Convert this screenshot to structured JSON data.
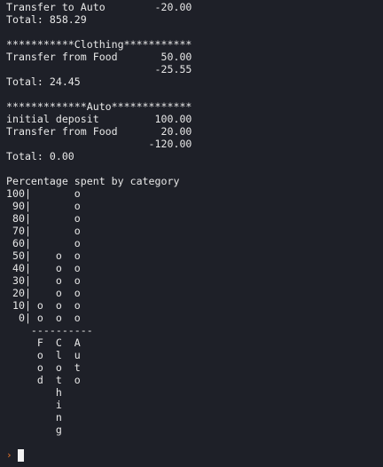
{
  "terminal": {
    "lines": [
      "Transfer to Auto        -20.00",
      "Total: 858.29",
      "",
      "***********Clothing***********",
      "Transfer from Food       50.00",
      "                        -25.55",
      "Total: 24.45",
      "",
      "*************Auto*************",
      "initial deposit         100.00",
      "Transfer from Food       20.00",
      "                       -120.00",
      "Total: 0.00",
      "",
      "Percentage spent by category",
      "100|       o",
      " 90|       o",
      " 80|       o",
      " 70|       o",
      " 60|       o",
      " 50|    o  o",
      " 40|    o  o",
      " 30|    o  o",
      " 20|    o  o",
      " 10| o  o  o",
      "  0| o  o  o",
      "    ----------",
      "     F  C  A",
      "     o  l  u",
      "     o  o  t",
      "     d  t  o",
      "        h",
      "        i",
      "        n",
      "        g"
    ],
    "prompt": {
      "glyph": "›",
      "icon": "prompt-arrow-icon",
      "accent_color": "#f0782a"
    }
  }
}
